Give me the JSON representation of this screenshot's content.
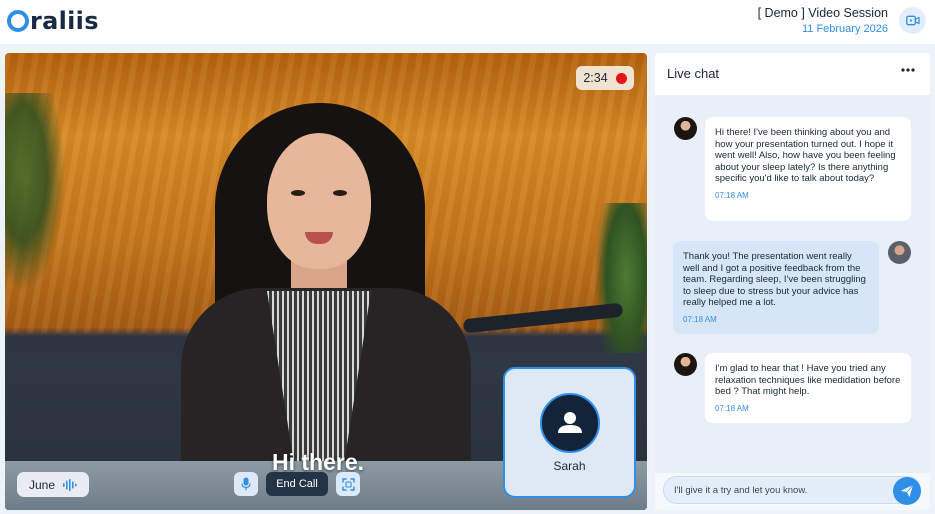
{
  "app": {
    "logo_text": "raliis",
    "logo_mark": "O"
  },
  "header": {
    "session_title": "[ Demo ] Video Session",
    "session_date": "11 February 2026",
    "video_icon": "video-camera-icon"
  },
  "video": {
    "timer": "2:34",
    "recording_indicator": "red-dot",
    "caption": "Hi there.",
    "speaker_name": "June",
    "speaker_icon": "audio-wave-icon",
    "controls": {
      "mic_icon": "microphone-icon",
      "end_call_label": "End Call",
      "fullscreen_icon": "fullscreen-icon"
    },
    "pip": {
      "name": "Sarah",
      "avatar_icon": "user-icon"
    }
  },
  "chat": {
    "title": "Live chat",
    "more_icon": "more-horizontal-icon",
    "messages": [
      {
        "side": "in",
        "text": "Hi there! I've been thinking about you and how your presentation turned out. I hope it went well! Also, how have you been feeling about your sleep lately? Is there anything specific you'd like to talk about today?",
        "time": "07:18 AM"
      },
      {
        "side": "out",
        "text": "Thank you! The presentation went really well and I got a positive feedback from the team. Regarding sleep, I've been struggling to sleep due to stress but your advice has really helped me a lot.",
        "time": "07:18 AM"
      },
      {
        "side": "in",
        "text": "I'm glad to hear that ! Have you tried any relaxation techniques like medidation before bed ? That might help.",
        "time": "07:18 AM"
      }
    ],
    "input_value": "I'll give it a try and let you know.",
    "send_icon": "send-icon"
  },
  "colors": {
    "accent": "#2f8fe8",
    "dark": "#233446",
    "record": "#e2151c"
  }
}
